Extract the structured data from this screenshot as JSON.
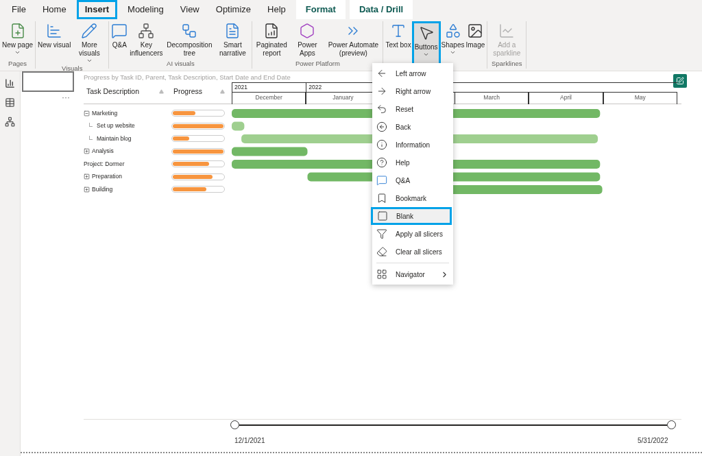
{
  "tabs": [
    {
      "label": "File",
      "selected": false,
      "kind": "plain"
    },
    {
      "label": "Home",
      "selected": false,
      "kind": "plain"
    },
    {
      "label": "Insert",
      "selected": true,
      "kind": "plain"
    },
    {
      "label": "Modeling",
      "selected": false,
      "kind": "plain"
    },
    {
      "label": "View",
      "selected": false,
      "kind": "plain"
    },
    {
      "label": "Optimize",
      "selected": false,
      "kind": "plain"
    },
    {
      "label": "Help",
      "selected": false,
      "kind": "plain"
    },
    {
      "label": "Format",
      "selected": false,
      "kind": "contextual"
    },
    {
      "label": "Data / Drill",
      "selected": false,
      "kind": "contextual"
    }
  ],
  "ribbon_groups": [
    {
      "label": "Pages",
      "items": [
        {
          "label": "New page",
          "dropdown": true,
          "disabled": false,
          "selected": false
        }
      ]
    },
    {
      "label": "Visuals",
      "items": [
        {
          "label": "New visual",
          "dropdown": false,
          "disabled": false,
          "selected": false
        },
        {
          "label": "More visuals",
          "dropdown": true,
          "disabled": false,
          "selected": false
        }
      ]
    },
    {
      "label": "AI visuals",
      "items": [
        {
          "label": "Q&A",
          "dropdown": false,
          "disabled": false,
          "selected": false
        },
        {
          "label": "Key influencers",
          "dropdown": false,
          "disabled": false,
          "selected": false
        },
        {
          "label": "Decomposition tree",
          "dropdown": false,
          "disabled": false,
          "selected": false
        },
        {
          "label": "Smart narrative",
          "dropdown": false,
          "disabled": false,
          "selected": false
        }
      ]
    },
    {
      "label": "Power Platform",
      "items": [
        {
          "label": "Paginated report",
          "dropdown": false,
          "disabled": false,
          "selected": false
        },
        {
          "label": "Power Apps",
          "dropdown": false,
          "disabled": false,
          "selected": false
        },
        {
          "label": "Power Automate (preview)",
          "dropdown": false,
          "disabled": false,
          "selected": false
        }
      ]
    },
    {
      "items": [
        {
          "label": "Text box",
          "dropdown": false,
          "disabled": false,
          "selected": false
        },
        {
          "label": "Buttons",
          "dropdown": true,
          "disabled": false,
          "selected": true
        },
        {
          "label": "Shapes",
          "dropdown": true,
          "disabled": false,
          "selected": false
        },
        {
          "label": "Image",
          "dropdown": false,
          "disabled": false,
          "selected": false
        }
      ]
    },
    {
      "label": "Sparklines",
      "items": [
        {
          "label": "Add a sparkline",
          "dropdown": false,
          "disabled": true,
          "selected": false
        }
      ]
    }
  ],
  "visual": {
    "title": "Progress by Task ID, Parent, Task Description, Start Date and End Date",
    "columns": [
      "Task Description",
      "Progress"
    ],
    "tasks": [
      {
        "name": "Marketing",
        "kind": "group",
        "expanded": true,
        "level": 0.45,
        "color": "#72b865",
        "children": [
          {
            "name": "Set up website",
            "kind": "leaf",
            "level": 1.0,
            "color": "#9fcf8f"
          },
          {
            "name": "Maintain blog",
            "kind": "leaf",
            "level": 0.33,
            "color": "#9fcf8f"
          }
        ]
      },
      {
        "name": "Analysis",
        "kind": "group",
        "expanded": false,
        "level": 1.0,
        "color": "#72b865"
      },
      {
        "name": "Project: Dormer",
        "kind": "plain",
        "level": 0.72,
        "color": "#72b865"
      },
      {
        "name": "Preparation",
        "kind": "group",
        "expanded": false,
        "level": 0.78,
        "color": "#72b865"
      },
      {
        "name": "Building",
        "kind": "group",
        "expanded": false,
        "level": 0.66,
        "color": "#72b865"
      }
    ],
    "timeline": {
      "years": [
        "2021",
        "2022"
      ],
      "months": [
        "December",
        "January",
        "March",
        "April",
        "May"
      ]
    },
    "slider": {
      "start": "12/1/2021",
      "end": "5/31/2022",
      "level": 1.0
    }
  },
  "page_thumbnail": {
    "more": "···"
  },
  "menu": {
    "items": [
      {
        "label": "Left arrow",
        "kind": "item",
        "selected": false
      },
      {
        "label": "Right arrow",
        "kind": "item",
        "selected": false
      },
      {
        "label": "Reset",
        "kind": "item",
        "selected": false
      },
      {
        "label": "Back",
        "kind": "item",
        "selected": false
      },
      {
        "label": "Information",
        "kind": "item",
        "selected": false
      },
      {
        "label": "Help",
        "kind": "item",
        "selected": false
      },
      {
        "label": "Q&A",
        "kind": "item",
        "selected": false
      },
      {
        "label": "Bookmark",
        "kind": "item",
        "selected": false
      },
      {
        "label": "Blank",
        "kind": "item",
        "selected": true
      },
      {
        "label": "Apply all slicers",
        "kind": "item",
        "selected": false
      },
      {
        "label": "Clear all slicers",
        "kind": "item",
        "selected": false
      },
      {
        "label": "Navigator",
        "kind": "submenu",
        "selected": false
      }
    ]
  }
}
